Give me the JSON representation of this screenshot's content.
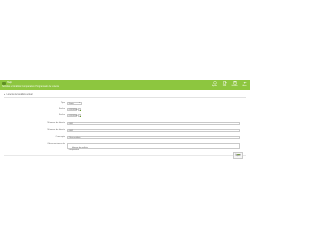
{
  "header": {
    "app_name": "Help",
    "subtitle": "Solicitar el Análisis Comparativo Programado de Lotería",
    "accent_color": "#8dc63f",
    "toolbar": [
      {
        "label": "Ayuda",
        "icon": "help-icon"
      },
      {
        "label": "Salir",
        "icon": "exit-icon"
      },
      {
        "label": "Guardar",
        "icon": "save-icon"
      },
      {
        "label": "Atras",
        "icon": "back-icon"
      }
    ]
  },
  "section": {
    "title": "Lotería del análisis actual"
  },
  "form": {
    "fields": [
      {
        "label": "Tipo",
        "value": "Diario"
      },
      {
        "label": "Fecha",
        "value": "01/01/2010"
      },
      {
        "label": "Fecha",
        "value": "01/01/2010"
      },
      {
        "label": "Número de lotería",
        "value": "0001"
      },
      {
        "label": "Número de lotería",
        "value": "0002"
      },
      {
        "label": "Concepto",
        "value": "Oficio análisis"
      },
      {
        "label": "Observaciones de",
        "value": "Informe de análisis\ncomparativo"
      }
    ]
  },
  "actions": {
    "submit_label": "Generar\nreporte"
  }
}
